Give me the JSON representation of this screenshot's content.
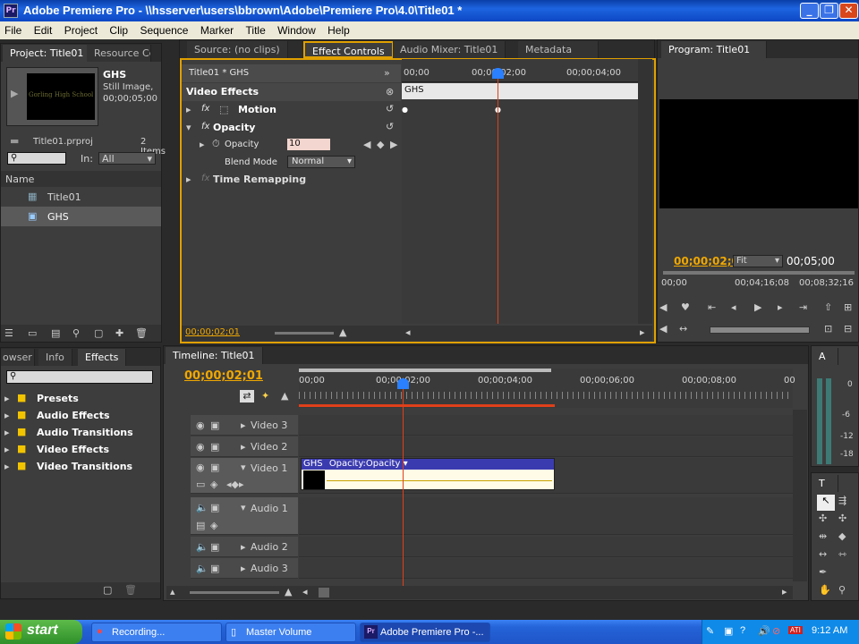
{
  "window": {
    "app_icon": "Pr",
    "title": "Adobe Premiere Pro - \\\\hsserver\\users\\bbrown\\Adobe\\Premiere Pro\\4.0\\Title01 *",
    "min": "_",
    "max": "❐",
    "close": "✕"
  },
  "menu": [
    "File",
    "Edit",
    "Project",
    "Clip",
    "Sequence",
    "Marker",
    "Title",
    "Window",
    "Help"
  ],
  "project_panel": {
    "tabs": [
      "Project: Title01",
      "Resource Ce"
    ],
    "thumb_text": "Gorling High School",
    "clip_name": "GHS",
    "clip_type": "Still Image, ...",
    "clip_duration": "00;00;05;00",
    "project_file": "Title01.prproj",
    "items_count": "2 Items",
    "in_label": "In:",
    "in_value": "All",
    "column_name": "Name",
    "items": [
      "Title01",
      "GHS"
    ]
  },
  "effect_controls": {
    "tabs": [
      "Source: (no clips)",
      "Effect Controls",
      "Audio Mixer: Title01",
      "Metadata"
    ],
    "header": "Title01 * GHS",
    "ruler": [
      "00;00",
      "00;00;02;00",
      "00;00;04;00"
    ],
    "clip_label": "GHS",
    "video_effects": "Video Effects",
    "motion": "Motion",
    "opacity": "Opacity",
    "opacity_prop": "Opacity",
    "opacity_value": "10",
    "blend_mode_label": "Blend Mode",
    "blend_mode_value": "Normal",
    "time_remap": "Time Remapping",
    "fx": "fx",
    "timecode": "00;00;02;01"
  },
  "program_monitor": {
    "tab": "Program: Title01",
    "timecode": "00;00;02;0",
    "fit": "Fit",
    "duration": "00;05;00",
    "ruler": [
      "00;00",
      "00;04;16;08",
      "00;08;32;16"
    ]
  },
  "effects_panel": {
    "tabs": [
      "owser",
      "Info",
      "Effects"
    ],
    "folders": [
      "Presets",
      "Audio Effects",
      "Audio Transitions",
      "Video Effects",
      "Video Transitions"
    ]
  },
  "timeline": {
    "tab": "Timeline: Title01",
    "timecode": "00;00;02;01",
    "ruler": [
      "00;00",
      "00;00;02;00",
      "00;00;04;00",
      "00;00;06;00",
      "00;00;08;00",
      "00"
    ],
    "tracks": [
      "Video 3",
      "Video 2",
      "Video 1",
      "Audio 1",
      "Audio 2",
      "Audio 3"
    ],
    "clip_name": "GHS",
    "clip_fx": "Opacity:Opacity"
  },
  "audio_meter": {
    "tab": "A",
    "labels": [
      "0",
      "-6",
      "-12",
      "-18"
    ]
  },
  "tools_panel": {
    "tab": "T"
  },
  "taskbar": {
    "start": "start",
    "items": [
      "Recording...",
      "Master Volume",
      "Adobe Premiere Pro -..."
    ],
    "clock": "9:12 AM"
  },
  "colors": {
    "accent": "#f0a800",
    "playhead": "#e0401a",
    "xp_blue": "#2463d8",
    "clip_blue": "#3b3bb0"
  }
}
